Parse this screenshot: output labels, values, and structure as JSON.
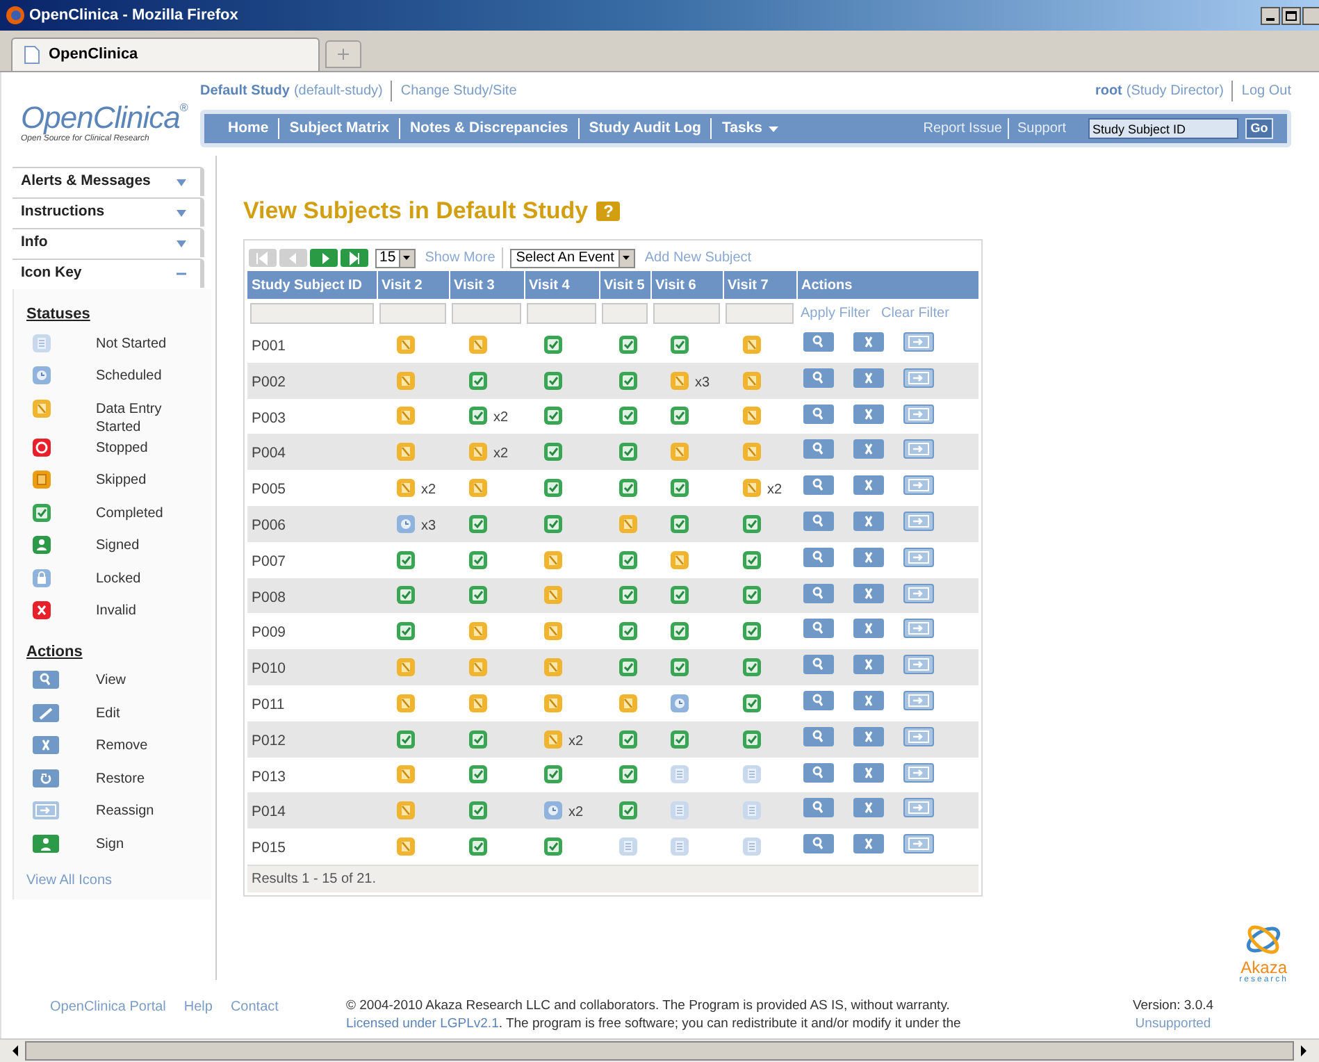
{
  "window": {
    "title": "OpenClinica - Mozilla Firefox"
  },
  "browser_tabs": [
    {
      "label": "OpenClinica",
      "selected": true
    }
  ],
  "header": {
    "study": "Default Study",
    "study_id": "(default-study)",
    "change_link": "Change Study/Site",
    "user": "root",
    "role": "(Study Director)",
    "logout": "Log Out",
    "logo": "OpenClinica",
    "logo_mark": "®",
    "tagline": "Open Source for Clinical Research"
  },
  "nav": {
    "items": [
      {
        "label": "Home",
        "dropdown": false
      },
      {
        "label": "Subject Matrix",
        "dropdown": false
      },
      {
        "label": "Notes & Discrepancies",
        "dropdown": false
      },
      {
        "label": "Study Audit Log",
        "dropdown": false
      },
      {
        "label": "Tasks",
        "dropdown": true
      }
    ],
    "links": [
      "Report Issue",
      "Support"
    ],
    "search": {
      "value": "Study Subject ID"
    },
    "go": "Go"
  },
  "sidebar": {
    "panels": [
      {
        "title": "Alerts & Messages",
        "expanded": false
      },
      {
        "title": "Instructions",
        "expanded": false
      },
      {
        "title": "Info",
        "expanded": false
      },
      {
        "title": "Icon Key",
        "expanded": true
      }
    ],
    "icon_key": {
      "sections": [
        {
          "title": "Statuses",
          "items": [
            {
              "kind": "not_started",
              "label": "Not Started"
            },
            {
              "kind": "scheduled",
              "label": "Scheduled"
            },
            {
              "kind": "started",
              "label": "Data Entry Started"
            },
            {
              "kind": "stopped",
              "label": "Stopped"
            },
            {
              "kind": "skipped",
              "label": "Skipped"
            },
            {
              "kind": "completed",
              "label": "Completed"
            },
            {
              "kind": "signed",
              "label": "Signed"
            },
            {
              "kind": "locked",
              "label": "Locked"
            },
            {
              "kind": "invalid",
              "label": "Invalid"
            }
          ]
        },
        {
          "title": "Actions",
          "items": [
            {
              "kind": "view",
              "label": "View"
            },
            {
              "kind": "edit",
              "label": "Edit"
            },
            {
              "kind": "remove",
              "label": "Remove"
            },
            {
              "kind": "restore",
              "label": "Restore"
            },
            {
              "kind": "reassign",
              "label": "Reassign"
            },
            {
              "kind": "sign",
              "label": "Sign"
            }
          ]
        }
      ],
      "link": "View All Icons"
    }
  },
  "main": {
    "title": "View Subjects in Default Study",
    "help": "?",
    "toolbar": {
      "pager": [
        {
          "kind": "first",
          "disabled": true
        },
        {
          "kind": "prev",
          "disabled": true
        },
        {
          "kind": "next",
          "disabled": false
        },
        {
          "kind": "last",
          "disabled": false
        }
      ],
      "page_size": "15",
      "show_more": "Show More",
      "event_select": "Select An Event",
      "add_link": "Add New Subject"
    },
    "table": {
      "columns": [
        "Study Subject ID",
        "Visit 2",
        "Visit 3",
        "Visit 4",
        "Visit 5",
        "Visit 6",
        "Visit 7",
        "Actions"
      ],
      "filter_links": [
        "Apply Filter",
        "Clear Filter"
      ],
      "row_actions": [
        {
          "kind": "view"
        },
        {
          "kind": "remove"
        },
        {
          "kind": "reassign"
        }
      ],
      "rows": [
        {
          "id": "P001",
          "visits": [
            {
              "kind": "started"
            },
            {
              "kind": "started"
            },
            {
              "kind": "completed"
            },
            {
              "kind": "completed"
            },
            {
              "kind": "completed"
            },
            {
              "kind": "started"
            }
          ]
        },
        {
          "id": "P002",
          "visits": [
            {
              "kind": "started"
            },
            {
              "kind": "completed"
            },
            {
              "kind": "completed"
            },
            {
              "kind": "completed"
            },
            {
              "kind": "started",
              "count": "x3"
            },
            {
              "kind": "started"
            }
          ]
        },
        {
          "id": "P003",
          "visits": [
            {
              "kind": "started"
            },
            {
              "kind": "completed",
              "count": "x2"
            },
            {
              "kind": "completed"
            },
            {
              "kind": "completed"
            },
            {
              "kind": "completed"
            },
            {
              "kind": "started"
            }
          ]
        },
        {
          "id": "P004",
          "visits": [
            {
              "kind": "started"
            },
            {
              "kind": "started",
              "count": "x2"
            },
            {
              "kind": "completed"
            },
            {
              "kind": "completed"
            },
            {
              "kind": "started"
            },
            {
              "kind": "started"
            }
          ]
        },
        {
          "id": "P005",
          "visits": [
            {
              "kind": "started",
              "count": "x2"
            },
            {
              "kind": "started"
            },
            {
              "kind": "completed"
            },
            {
              "kind": "completed"
            },
            {
              "kind": "completed"
            },
            {
              "kind": "started",
              "count": "x2"
            }
          ]
        },
        {
          "id": "P006",
          "visits": [
            {
              "kind": "scheduled",
              "count": "x3"
            },
            {
              "kind": "completed"
            },
            {
              "kind": "completed"
            },
            {
              "kind": "started"
            },
            {
              "kind": "completed"
            },
            {
              "kind": "completed"
            }
          ]
        },
        {
          "id": "P007",
          "visits": [
            {
              "kind": "completed"
            },
            {
              "kind": "completed"
            },
            {
              "kind": "started"
            },
            {
              "kind": "completed"
            },
            {
              "kind": "started"
            },
            {
              "kind": "completed"
            }
          ]
        },
        {
          "id": "P008",
          "visits": [
            {
              "kind": "completed"
            },
            {
              "kind": "completed"
            },
            {
              "kind": "started"
            },
            {
              "kind": "completed"
            },
            {
              "kind": "completed"
            },
            {
              "kind": "completed"
            }
          ]
        },
        {
          "id": "P009",
          "visits": [
            {
              "kind": "completed"
            },
            {
              "kind": "started"
            },
            {
              "kind": "started"
            },
            {
              "kind": "completed"
            },
            {
              "kind": "completed"
            },
            {
              "kind": "completed"
            }
          ]
        },
        {
          "id": "P010",
          "visits": [
            {
              "kind": "started"
            },
            {
              "kind": "started"
            },
            {
              "kind": "started"
            },
            {
              "kind": "completed"
            },
            {
              "kind": "completed"
            },
            {
              "kind": "completed"
            }
          ]
        },
        {
          "id": "P011",
          "visits": [
            {
              "kind": "started"
            },
            {
              "kind": "started"
            },
            {
              "kind": "started"
            },
            {
              "kind": "started"
            },
            {
              "kind": "scheduled"
            },
            {
              "kind": "completed"
            }
          ]
        },
        {
          "id": "P012",
          "visits": [
            {
              "kind": "completed"
            },
            {
              "kind": "completed"
            },
            {
              "kind": "started",
              "count": "x2"
            },
            {
              "kind": "completed"
            },
            {
              "kind": "completed"
            },
            {
              "kind": "completed"
            }
          ]
        },
        {
          "id": "P013",
          "visits": [
            {
              "kind": "started"
            },
            {
              "kind": "completed"
            },
            {
              "kind": "completed"
            },
            {
              "kind": "completed"
            },
            {
              "kind": "not_started"
            },
            {
              "kind": "not_started"
            }
          ]
        },
        {
          "id": "P014",
          "visits": [
            {
              "kind": "started"
            },
            {
              "kind": "completed"
            },
            {
              "kind": "scheduled",
              "count": "x2"
            },
            {
              "kind": "completed"
            },
            {
              "kind": "not_started"
            },
            {
              "kind": "not_started"
            }
          ]
        },
        {
          "id": "P015",
          "visits": [
            {
              "kind": "started"
            },
            {
              "kind": "completed"
            },
            {
              "kind": "completed"
            },
            {
              "kind": "not_started"
            },
            {
              "kind": "not_started"
            },
            {
              "kind": "not_started"
            }
          ]
        }
      ],
      "results": "Results 1 - 15 of 21."
    }
  },
  "footer": {
    "links": [
      "OpenClinica Portal",
      "Help",
      "Contact"
    ],
    "copyright": "© 2004-2010 Akaza Research LLC and collaborators. The Program is provided AS IS, without warranty.",
    "license_link": "Licensed under LGPLv2.1",
    "license_text": ". The program is free software; you can redistribute it and/or modify it under the",
    "version": "Version: 3.0.4",
    "support": "Unsupported",
    "brand": "Akaza",
    "brand_sub": "research"
  }
}
